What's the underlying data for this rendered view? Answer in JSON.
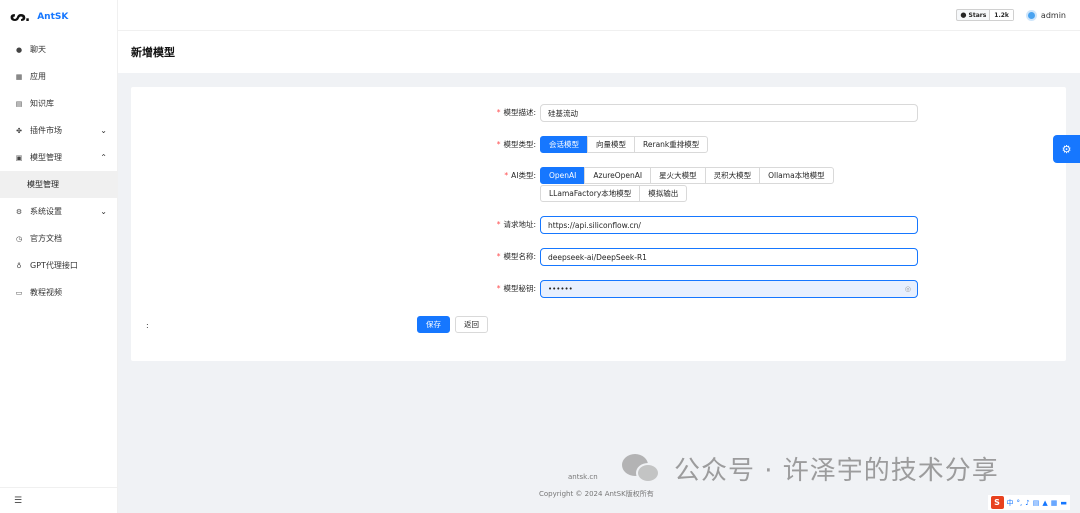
{
  "app": {
    "logo_mark": "$%",
    "name": "AntSK"
  },
  "header": {
    "github_label": "Stars",
    "github_count": "1.2k",
    "user_name": "admin"
  },
  "sidebar": {
    "items": [
      {
        "label": "聊天",
        "icon": "chat-icon"
      },
      {
        "label": "应用",
        "icon": "apps-icon"
      },
      {
        "label": "知识库",
        "icon": "book-icon"
      },
      {
        "label": "插件市场",
        "icon": "plugin-icon"
      },
      {
        "label": "模型管理",
        "icon": "model-icon"
      },
      {
        "label": "模型管理",
        "icon": ""
      },
      {
        "label": "系统设置",
        "icon": "settings-icon"
      },
      {
        "label": "官方文档",
        "icon": "doc-icon"
      },
      {
        "label": "GPT代理接口",
        "icon": "bulb-icon"
      },
      {
        "label": "教程视频",
        "icon": "video-icon"
      }
    ]
  },
  "page": {
    "title": "新增模型"
  },
  "form": {
    "desc_label": "模型描述:",
    "desc_value": "硅基流动",
    "type_label": "模型类型:",
    "type_options": [
      "会话模型",
      "向量模型",
      "Rerank重排模型"
    ],
    "ai_type_label": "AI类型:",
    "ai_type_options_row1": [
      "OpenAI",
      "AzureOpenAI",
      "星火大模型",
      "灵积大模型",
      "Ollama本地模型"
    ],
    "ai_type_options_row2": [
      "LLamaFactory本地模型",
      "模拟输出"
    ],
    "endpoint_label": "请求地址:",
    "endpoint_value": "https://api.siliconflow.cn/",
    "model_name_label": "模型名称:",
    "model_name_value": "deepseek-ai/DeepSeek-R1",
    "secret_label": "模型秘钥:",
    "secret_value": "••••••",
    "colon": ":",
    "save_label": "保存",
    "back_label": "返回"
  },
  "footer": {
    "link": "antsk.cn",
    "copyright": "Copyright © 2024 AntSK版权所有"
  },
  "watermark": {
    "text": "公众号 · 许泽宇的技术分享"
  },
  "tray": {
    "lang": "中",
    "punct": "°,"
  },
  "colors": {
    "primary": "#1677ff",
    "required": "#ff4d4f"
  }
}
